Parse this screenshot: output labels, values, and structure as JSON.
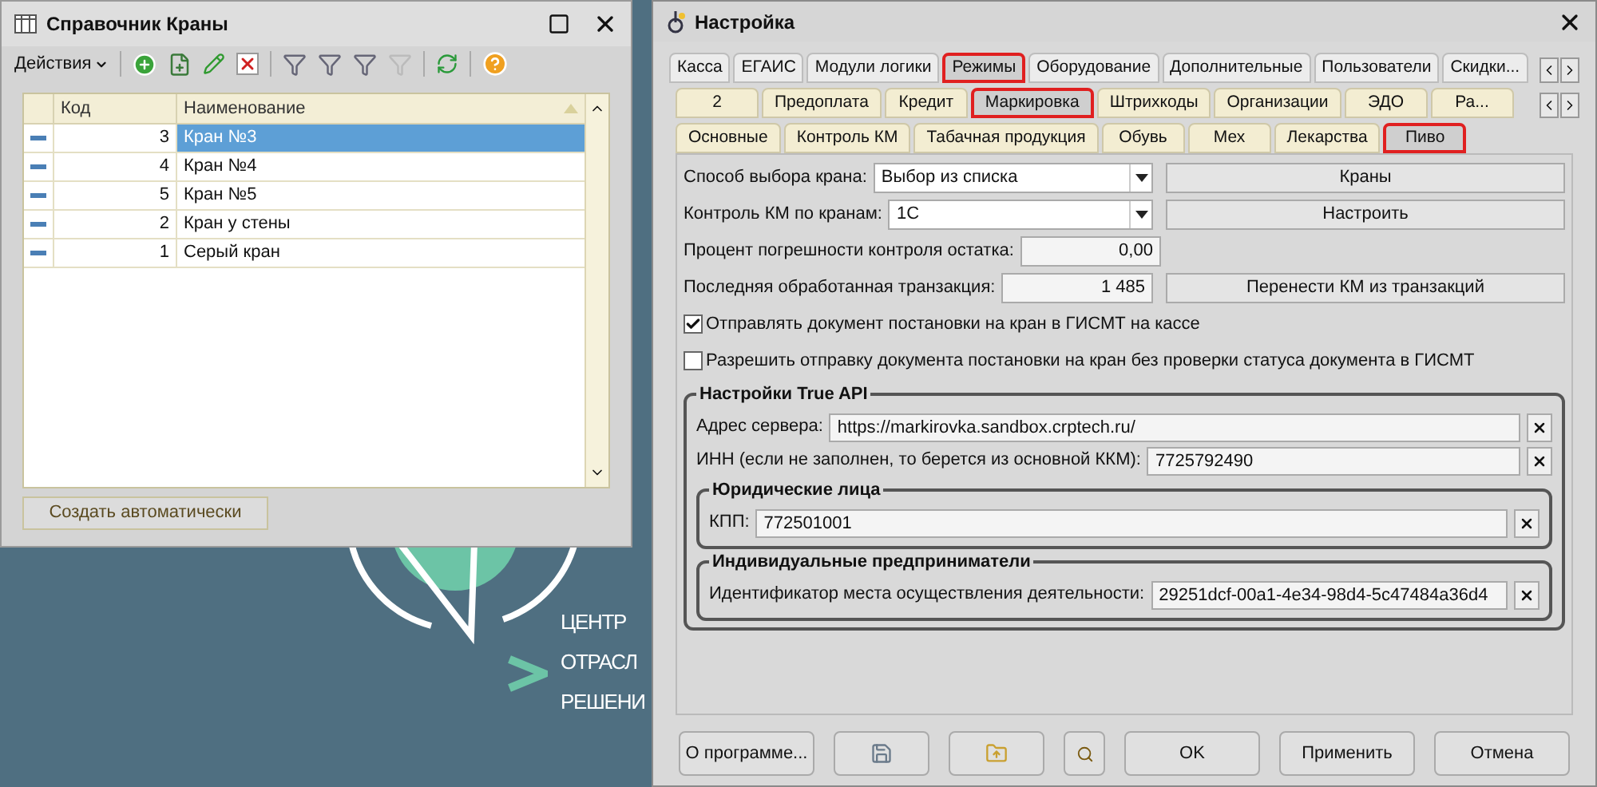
{
  "directory_window": {
    "title": "Справочник Краны",
    "actions_menu": "Действия",
    "columns": [
      "Код",
      "Наименование"
    ],
    "rows": [
      {
        "code": "3",
        "name": "Кран №3",
        "selected": true
      },
      {
        "code": "4",
        "name": "Кран №4",
        "selected": false
      },
      {
        "code": "5",
        "name": "Кран №5",
        "selected": false
      },
      {
        "code": "2",
        "name": "Кран у стены",
        "selected": false
      },
      {
        "code": "1",
        "name": "Серый кран",
        "selected": false
      }
    ],
    "create_button": "Создать автоматически"
  },
  "desktop_logo": {
    "lines": [
      "ЦЕНТР",
      "ОТРАСЛ",
      "РЕШЕНИ"
    ]
  },
  "settings_window": {
    "title": "Настройка",
    "tabs": [
      {
        "label": "Касса",
        "selected": false
      },
      {
        "label": "ЕГАИС",
        "selected": false
      },
      {
        "label": "Модули логики",
        "selected": false
      },
      {
        "label": "Режимы",
        "selected": true
      },
      {
        "label": "Оборудование",
        "selected": false
      },
      {
        "label": "Дополнительные",
        "selected": false
      },
      {
        "label": "Пользователи",
        "selected": false
      },
      {
        "label": "Скидки...",
        "selected": false
      }
    ],
    "subtabs": [
      {
        "label": "2",
        "selected": false
      },
      {
        "label": "Предоплата",
        "selected": false
      },
      {
        "label": "Кредит",
        "selected": false
      },
      {
        "label": "Маркировка",
        "selected": true
      },
      {
        "label": "Штрихкоды",
        "selected": false
      },
      {
        "label": "Организации",
        "selected": false
      },
      {
        "label": "ЭДО",
        "selected": false
      },
      {
        "label": "Ра...",
        "selected": false
      }
    ],
    "subsubtabs": [
      {
        "label": "Основные",
        "selected": false
      },
      {
        "label": "Контроль КМ",
        "selected": false
      },
      {
        "label": "Табачная продукция",
        "selected": false
      },
      {
        "label": "Обувь",
        "selected": false
      },
      {
        "label": "Мех",
        "selected": false
      },
      {
        "label": "Лекарства",
        "selected": false
      },
      {
        "label": "Пиво",
        "selected": true
      }
    ],
    "rows": [
      {
        "kind": "select",
        "label": "Способ выбора крана:",
        "value": "Выбор из списка",
        "button": "Краны"
      },
      {
        "kind": "select",
        "label": "Контроль КМ по кранам:",
        "value": "1С",
        "button": "Настроить"
      },
      {
        "kind": "number",
        "label": "Процент погрешности контроля остатка:",
        "value": "0,00"
      },
      {
        "kind": "number",
        "label": "Последняя обработанная транзакция:",
        "value": "1 485",
        "button": "Перенести КМ из транзакций"
      }
    ],
    "checkboxes": [
      {
        "label": "Отправлять документ постановки на кран в ГИСМТ на кассе",
        "checked": true
      },
      {
        "label": "Разрешить отправку документа постановки на кран без проверки статуса документа в ГИСМТ",
        "checked": false
      }
    ],
    "true_api": {
      "title": "Настройки True API",
      "fields": [
        {
          "label": "Адрес сервера:",
          "value": "https://markirovka.sandbox.crptech.ru/"
        },
        {
          "label": "ИНН (если не заполнен, то берется из основной ККМ):",
          "value": "7725792490"
        }
      ],
      "groups": [
        {
          "title": "Юридические лица",
          "fields": [
            {
              "label": "КПП:",
              "value": "772501001"
            }
          ]
        },
        {
          "title": "Индивидуальные предприниматели",
          "fields": [
            {
              "label": "Идентификатор места осуществления деятельности:",
              "value": "29251dcf-00a1-4e34-98d4-5c47484a36d4"
            }
          ]
        }
      ]
    },
    "buttons": [
      {
        "kind": "text",
        "label": "О программе..."
      },
      {
        "kind": "save"
      },
      {
        "kind": "open"
      },
      {
        "kind": "search"
      },
      {
        "kind": "text",
        "label": "OK"
      },
      {
        "kind": "text",
        "label": "Применить"
      },
      {
        "kind": "text",
        "label": "Отмена"
      }
    ]
  }
}
